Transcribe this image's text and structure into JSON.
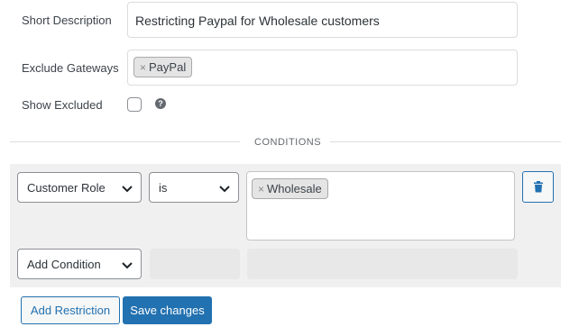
{
  "form": {
    "short_description_label": "Short Description",
    "short_description_value": "Restricting Paypal for Wholesale customers",
    "exclude_gateways_label": "Exclude Gateways",
    "exclude_gateways_chip": "PayPal",
    "show_excluded_label": "Show Excluded",
    "show_excluded_checked": false,
    "help_icon": "?"
  },
  "conditions": {
    "section_title": "CONDITIONS",
    "rows": [
      {
        "field": "Customer Role",
        "operator": "is",
        "value_chip": "Wholesale"
      }
    ],
    "add_condition_select": "Add Condition",
    "delete_icon": "trash-icon"
  },
  "actions": {
    "add_restriction_label": "Add Restriction",
    "save_changes_label": "Save changes"
  },
  "colors": {
    "accent": "#2271b1",
    "panel_bg": "#f0f0f1",
    "chip_bg": "#e4e4e4"
  },
  "chip_remove_glyph": "×"
}
